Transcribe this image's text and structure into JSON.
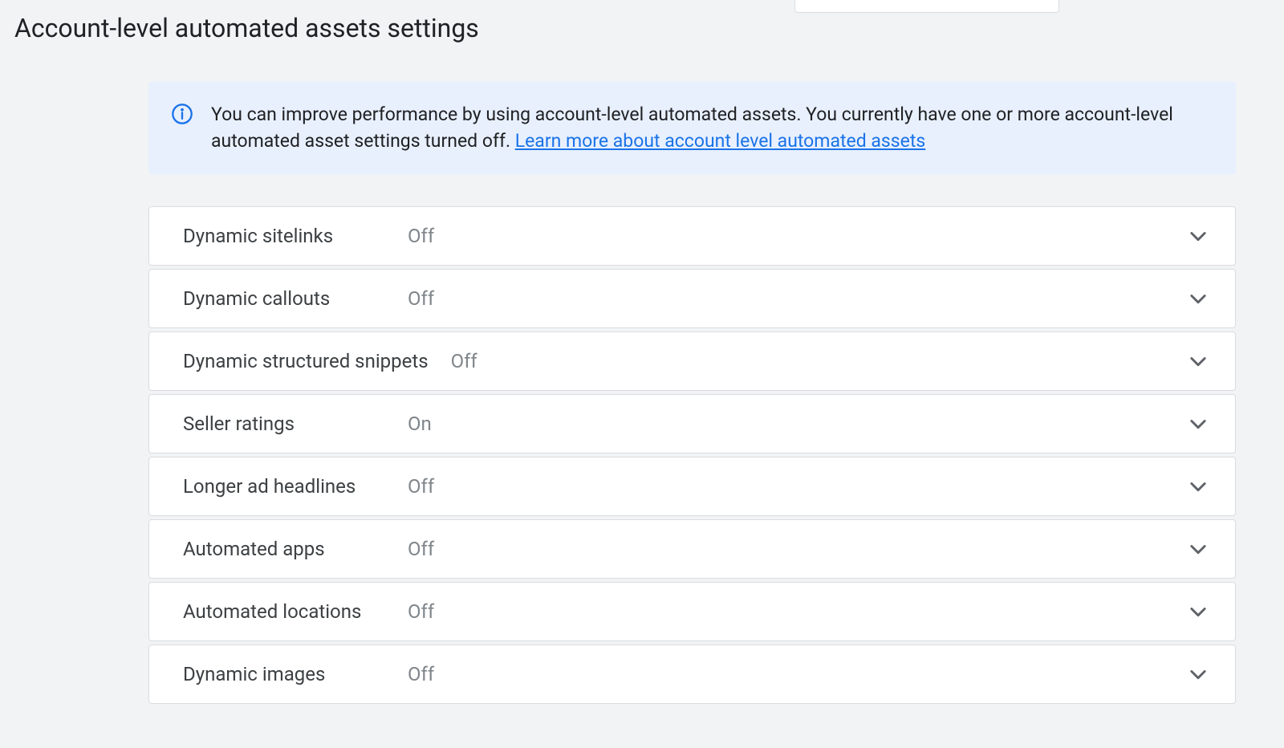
{
  "header": {
    "title": "Account-level automated assets settings"
  },
  "banner": {
    "text": "You can improve performance by using account-level automated assets. You currently have one or more account-level automated asset settings turned off. ",
    "link_text": "Learn more about account level automated assets"
  },
  "settings": {
    "dynamic_sitelinks": {
      "label": "Dynamic sitelinks",
      "status": "Off"
    },
    "dynamic_callouts": {
      "label": "Dynamic callouts",
      "status": "Off"
    },
    "dynamic_structured_snippets": {
      "label": "Dynamic structured snippets",
      "status": "Off"
    },
    "seller_ratings": {
      "label": "Seller ratings",
      "status": "On"
    },
    "longer_ad_headlines": {
      "label": "Longer ad headlines",
      "status": "Off"
    },
    "automated_apps": {
      "label": "Automated apps",
      "status": "Off"
    },
    "automated_locations": {
      "label": "Automated locations",
      "status": "Off"
    },
    "dynamic_images": {
      "label": "Dynamic images",
      "status": "Off"
    }
  }
}
